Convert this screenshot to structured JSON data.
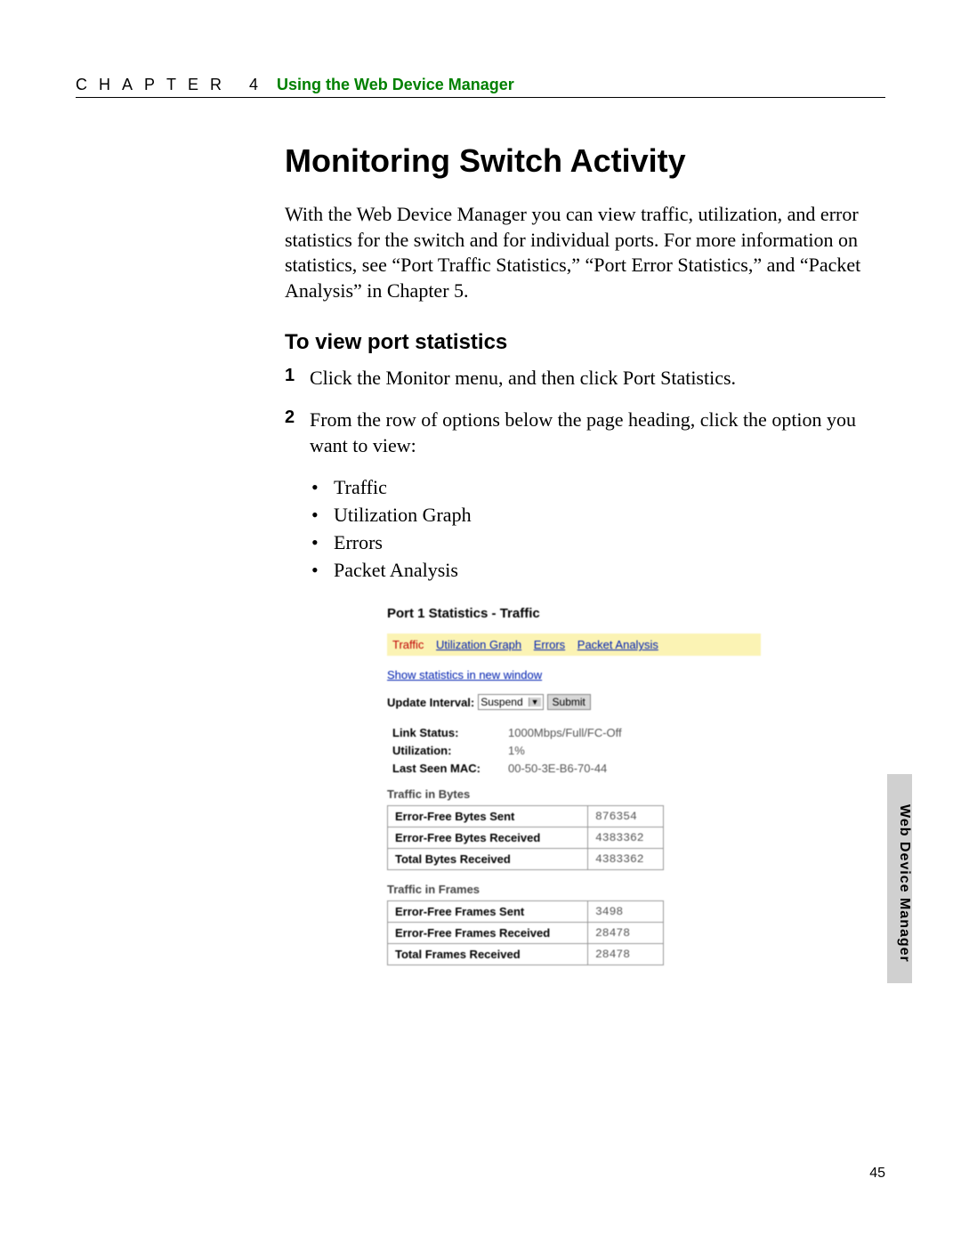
{
  "header": {
    "chapter_label": "CHAPTER 4",
    "chapter_title": "Using the Web Device Manager"
  },
  "main": {
    "heading": "Monitoring Switch Activity",
    "intro": "With the Web Device Manager you can view traffic, utilization, and error statistics for the switch and for individual ports. For more information on statistics, see “Port Traffic Statistics,” “Port Error Statistics,” and “Packet Analysis” in Chapter 5.",
    "sub_heading": "To view port statistics",
    "steps": [
      {
        "num": "1",
        "text": "Click the Monitor menu, and then click Port Statistics."
      },
      {
        "num": "2",
        "text": "From the row of options below the page heading, click the option you want to view:"
      }
    ],
    "bullets": [
      "Traffic",
      "Utilization Graph",
      "Errors",
      "Packet Analysis"
    ]
  },
  "screenshot": {
    "title": "Port 1 Statistics - Traffic",
    "tabs": {
      "traffic": "Traffic",
      "utilization": "Utilization Graph",
      "errors": "Errors",
      "packet": "Packet Analysis"
    },
    "new_window_link": "Show statistics in new window",
    "update_label": "Update Interval:",
    "select_value": "Suspend",
    "submit_label": "Submit",
    "info": {
      "link_status_label": "Link Status:",
      "link_status_value": "1000Mbps/Full/FC-Off",
      "utilization_label": "Utilization:",
      "utilization_value": "1%",
      "last_mac_label": "Last Seen MAC:",
      "last_mac_value": "00-50-3E-B6-70-44"
    },
    "bytes_title": "Traffic in Bytes",
    "bytes_table": [
      {
        "label": "Error-Free Bytes Sent",
        "value": "876354"
      },
      {
        "label": "Error-Free Bytes Received",
        "value": "4383362"
      },
      {
        "label": "Total Bytes Received",
        "value": "4383362"
      }
    ],
    "frames_title": "Traffic in Frames",
    "frames_table": [
      {
        "label": "Error-Free Frames Sent",
        "value": "3498"
      },
      {
        "label": "Error-Free Frames Received",
        "value": "28478"
      },
      {
        "label": "Total Frames Received",
        "value": "28478"
      }
    ]
  },
  "side_tab": "Web Device Manager",
  "page_number": "45"
}
